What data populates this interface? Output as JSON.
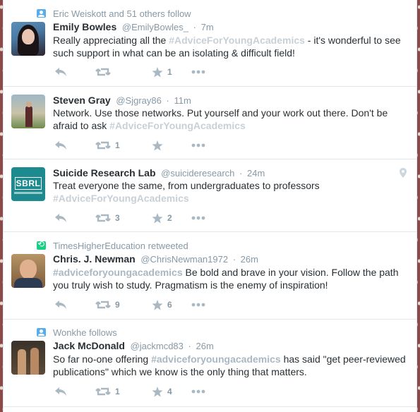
{
  "tweets": [
    {
      "context": {
        "type": "follow",
        "text": "Eric Weiskott and 51 others follow"
      },
      "fullname": "Emily Bowles",
      "username": "@EmilyBowles_",
      "time": "7m",
      "text_before": "Really appreciating all the ",
      "hashtag": "#AdviceForYoungAcademics",
      "text_after": " - it's wonderful to see such support in what can be an isolating & difficult field!",
      "retweets": "",
      "favorites": "1"
    },
    {
      "fullname": "Steven Gray",
      "username": "@Sjgray86",
      "time": "11m",
      "text_before": "Network. Use those networks. Put yourself and your work out there. Don't be afraid to ask ",
      "hashtag": "#AdviceForYoungAcademics",
      "text_after": "",
      "retweets": "1",
      "favorites": ""
    },
    {
      "fullname": "Suicide Research Lab",
      "username": "@suicideresearch",
      "time": "24m",
      "avatar_text": "SBRL",
      "text_before": "Treat everyone the same, from undergraduates to professors ",
      "hashtag": "#AdviceForYoungAcademics",
      "text_after": "",
      "retweets": "3",
      "favorites": "2"
    },
    {
      "context": {
        "type": "retweet",
        "text": "TimesHigherEducation retweeted"
      },
      "fullname": "Chris. J. Newman",
      "username": "@ChrisNewman1972",
      "time": "26m",
      "text_before": "",
      "hashtag": "#adviceforyoungacademics",
      "text_after": " Be bold and brave in your vision. Follow the path you truly wish to study. Pragmatism is the enemy of inspiration!",
      "retweets": "9",
      "favorites": "6"
    },
    {
      "context": {
        "type": "follow",
        "text": "Wonkhe follows"
      },
      "fullname": "Jack McDonald",
      "username": "@jackmcd83",
      "time": "26m",
      "text_before": "So far no-one offering ",
      "hashtag": "#adviceforyoungacademics",
      "text_after": " has said \"get peer-reviewed publications\" which we know is the only thing that matters.",
      "retweets": "1",
      "favorites": "4"
    }
  ],
  "separator": "·",
  "icons": {
    "follow_context": "person-icon",
    "retweet_context": "retweet-icon",
    "reply": "reply-icon",
    "retweet": "retweet-icon",
    "favorite": "star-icon",
    "more": "more-icon",
    "geo": "location-pin-icon"
  },
  "colors": {
    "follow": "#55acee",
    "retweet": "#19cf86",
    "muted": "#8899a6"
  }
}
